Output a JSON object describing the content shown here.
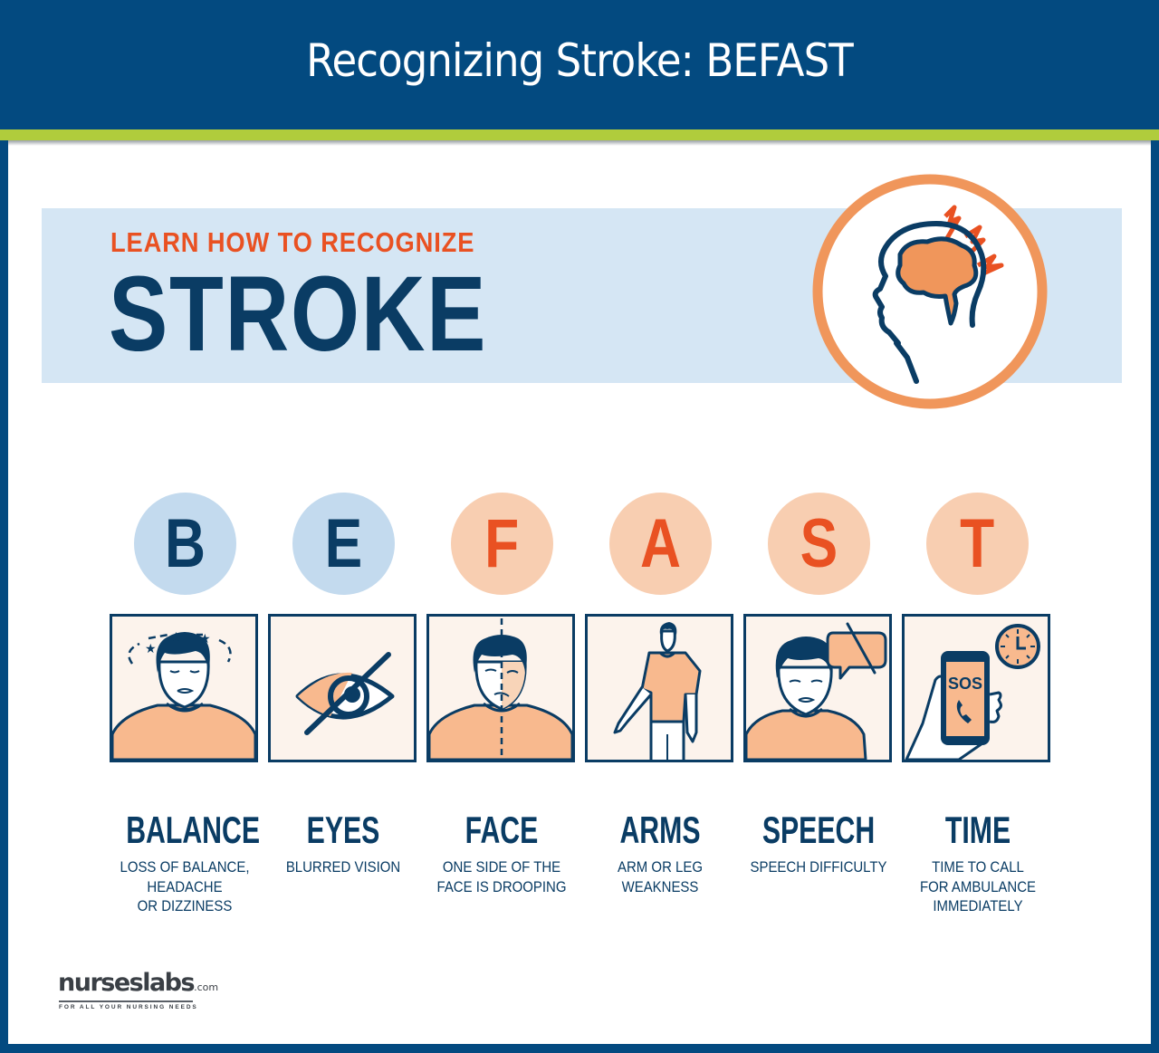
{
  "header": {
    "title": "Recognizing Stroke: BEFAST"
  },
  "banner": {
    "subtitle": "LEARN HOW TO RECOGNIZE",
    "title": "STROKE",
    "icon": "head-brain-lightning-icon"
  },
  "colors": {
    "navy": "#0a3c64",
    "frame_blue": "#034a80",
    "accent_green": "#b0cc3c",
    "accent_orange": "#e95122",
    "light_orange": "#f8ceb1",
    "light_blue": "#c3daee",
    "banner_blue": "#d5e6f4"
  },
  "befast": [
    {
      "letter": "B",
      "title": "BALANCE",
      "description": "LOSS OF BALANCE,\nHEADACHE\nOR DIZZINESS",
      "icon": "dizzy-person-icon",
      "tone": "blue"
    },
    {
      "letter": "E",
      "title": "EYES",
      "description": "BLURRED VISION",
      "icon": "eye-slash-icon",
      "tone": "blue"
    },
    {
      "letter": "F",
      "title": "FACE",
      "description": "ONE SIDE OF THE\nFACE IS DROOPING",
      "icon": "drooping-face-icon",
      "tone": "orange"
    },
    {
      "letter": "A",
      "title": "ARMS",
      "description": "ARM OR LEG\nWEAKNESS",
      "icon": "arm-weakness-icon",
      "tone": "orange"
    },
    {
      "letter": "S",
      "title": "SPEECH",
      "description": "SPEECH DIFFICULTY",
      "icon": "no-speech-icon",
      "tone": "orange"
    },
    {
      "letter": "T",
      "title": "TIME",
      "description": "TIME TO CALL\nFOR AMBULANCE\nIMMEDIATELY",
      "icon": "sos-phone-clock-icon",
      "tone": "orange",
      "sos_text": "SOS"
    }
  ],
  "logo": {
    "name": "nurseslabs",
    "suffix": ".com",
    "tagline": "FOR ALL YOUR NURSING NEEDS"
  }
}
